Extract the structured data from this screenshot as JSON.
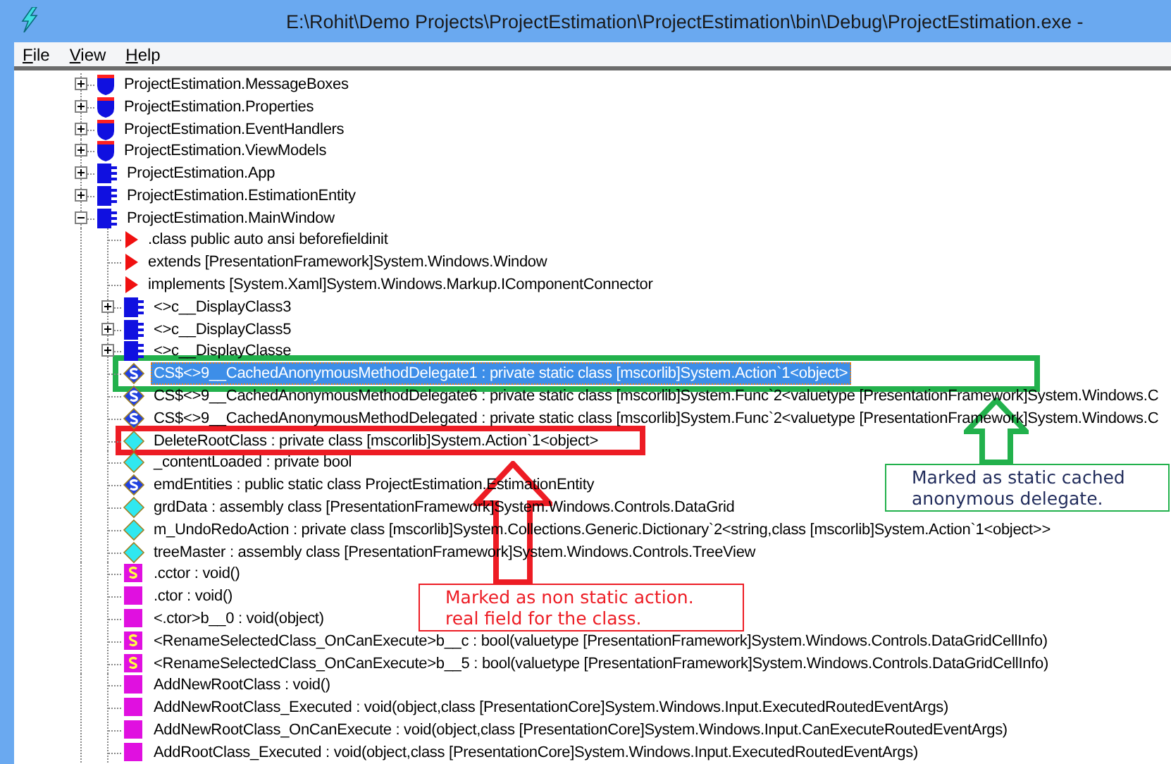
{
  "window": {
    "title": "E:\\Rohit\\Demo Projects\\ProjectEstimation\\ProjectEstimation\\bin\\Debug\\ProjectEstimation.exe -"
  },
  "menu": [
    "File",
    "View",
    "Help"
  ],
  "tree": [
    {
      "label": "ProjectEstimation.MessageBoxes",
      "kind": "namespace",
      "expandable": true,
      "expanded": false,
      "selected": false
    },
    {
      "label": "ProjectEstimation.Properties",
      "kind": "namespace",
      "expandable": true,
      "expanded": false,
      "selected": false
    },
    {
      "label": "ProjectEstimation.EventHandlers",
      "kind": "namespace",
      "expandable": true,
      "expanded": false,
      "selected": false
    },
    {
      "label": "ProjectEstimation.ViewModels",
      "kind": "namespace",
      "expandable": true,
      "expanded": false,
      "selected": false
    },
    {
      "label": "ProjectEstimation.App",
      "kind": "class",
      "expandable": true,
      "expanded": false,
      "selected": false
    },
    {
      "label": "ProjectEstimation.EstimationEntity",
      "kind": "class",
      "expandable": true,
      "expanded": false,
      "selected": false
    },
    {
      "label": "ProjectEstimation.MainWindow",
      "kind": "class",
      "expandable": true,
      "expanded": true,
      "selected": false,
      "children": [
        {
          "label": ".class public auto ansi beforefieldinit",
          "kind": "info",
          "selected": false
        },
        {
          "label": "extends [PresentationFramework]System.Windows.Window",
          "kind": "info",
          "selected": false
        },
        {
          "label": "implements [System.Xaml]System.Windows.Markup.IComponentConnector",
          "kind": "info",
          "selected": false
        },
        {
          "label": "<>c__DisplayClass3",
          "kind": "class",
          "expandable": true,
          "expanded": false,
          "selected": false
        },
        {
          "label": "<>c__DisplayClass5",
          "kind": "class",
          "expandable": true,
          "expanded": false,
          "selected": false
        },
        {
          "label": "<>c__DisplayClasse",
          "kind": "class",
          "expandable": true,
          "expanded": false,
          "selected": false
        },
        {
          "label": "CS$<>9__CachedAnonymousMethodDelegate1 : private static class [mscorlib]System.Action`1<object>",
          "kind": "field",
          "static": true,
          "selected": true
        },
        {
          "label": "CS$<>9__CachedAnonymousMethodDelegate6 : private static class [mscorlib]System.Func`2<valuetype [PresentationFramework]System.Windows.C",
          "kind": "field",
          "static": true,
          "selected": false
        },
        {
          "label": "CS$<>9__CachedAnonymousMethodDelegated : private static class [mscorlib]System.Func`2<valuetype [PresentationFramework]System.Windows.C",
          "kind": "field",
          "static": true,
          "selected": false
        },
        {
          "label": "DeleteRootClass : private class [mscorlib]System.Action`1<object>",
          "kind": "field",
          "static": false,
          "selected": false
        },
        {
          "label": "_contentLoaded : private bool",
          "kind": "field",
          "static": false,
          "selected": false
        },
        {
          "label": "emdEntities : public static class ProjectEstimation.EstimationEntity",
          "kind": "field",
          "static": true,
          "selected": false
        },
        {
          "label": "grdData : assembly class [PresentationFramework]System.Windows.Controls.DataGrid",
          "kind": "field",
          "static": false,
          "selected": false
        },
        {
          "label": "m_UndoRedoAction : private class [mscorlib]System.Collections.Generic.Dictionary`2<string,class [mscorlib]System.Action`1<object>>",
          "kind": "field",
          "static": false,
          "selected": false
        },
        {
          "label": "treeMaster : assembly class [PresentationFramework]System.Windows.Controls.TreeView",
          "kind": "field",
          "static": false,
          "selected": false
        },
        {
          "label": ".cctor : void()",
          "kind": "method",
          "static": true,
          "selected": false
        },
        {
          "label": ".ctor : void()",
          "kind": "method",
          "static": false,
          "selected": false
        },
        {
          "label": "<.ctor>b__0 : void(object)",
          "kind": "method",
          "static": false,
          "selected": false
        },
        {
          "label": "<RenameSelectedClass_OnCanExecute>b__c : bool(valuetype [PresentationFramework]System.Windows.Controls.DataGridCellInfo)",
          "kind": "method",
          "static": true,
          "selected": false
        },
        {
          "label": "<RenameSelectedClass_OnCanExecute>b__5 : bool(valuetype [PresentationFramework]System.Windows.Controls.DataGridCellInfo)",
          "kind": "method",
          "static": true,
          "selected": false
        },
        {
          "label": "AddNewRootClass : void()",
          "kind": "method",
          "static": false,
          "selected": false
        },
        {
          "label": "AddNewRootClass_Executed : void(object,class [PresentationCore]System.Windows.Input.ExecutedRoutedEventArgs)",
          "kind": "method",
          "static": false,
          "selected": false
        },
        {
          "label": "AddNewRootClass_OnCanExecute : void(object,class [PresentationCore]System.Windows.Input.CanExecuteRoutedEventArgs)",
          "kind": "method",
          "static": false,
          "selected": false
        },
        {
          "label": "AddRootClass_Executed : void(object,class [PresentationCore]System.Windows.Input.ExecutedRoutedEventArgs)",
          "kind": "method",
          "static": false,
          "selected": false
        }
      ]
    }
  ],
  "annotations": [
    {
      "color": "#22b14c",
      "text_colored": false,
      "lines": [
        "Marked as static cached",
        "anonymous delegate."
      ]
    },
    {
      "color": "#ed1c24",
      "text_colored": true,
      "lines": [
        "Marked as non static action.",
        "real field for the class."
      ]
    }
  ]
}
